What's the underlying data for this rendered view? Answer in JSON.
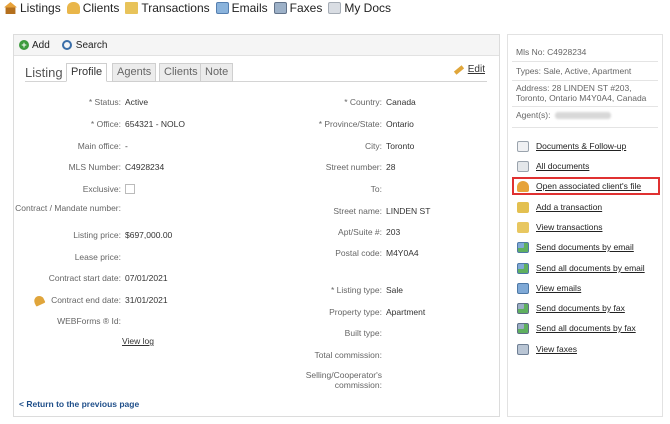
{
  "nav": {
    "items": [
      {
        "label": "Listings",
        "icon": "house-icon"
      },
      {
        "label": "Clients",
        "icon": "clients-icon"
      },
      {
        "label": "Transactions",
        "icon": "folder-icon"
      },
      {
        "label": "Emails",
        "icon": "email-icon"
      },
      {
        "label": "Faxes",
        "icon": "fax-icon"
      },
      {
        "label": "My Docs",
        "icon": "docs-icon"
      }
    ]
  },
  "toolbar": {
    "add_label": "Add",
    "search_label": "Search"
  },
  "tabs": {
    "title": "Listing",
    "items": [
      "Profile",
      "Agents",
      "Clients",
      "Note"
    ],
    "active": "Profile",
    "edit_label": "Edit"
  },
  "left_fields": [
    {
      "label": "* Status:",
      "value": "Active"
    },
    {
      "label": "* Office:",
      "value": "654321 - NOLO"
    },
    {
      "label": "Main office:",
      "value": "-"
    },
    {
      "label": "MLS Number:",
      "value": "C4928234"
    },
    {
      "label": "Exclusive:",
      "value": ""
    },
    {
      "label": "Contract / Mandate number:",
      "value": ""
    },
    {
      "label": "Listing price:",
      "value": "$697,000.00"
    },
    {
      "label": "Lease price:",
      "value": ""
    },
    {
      "label": "Contract start date:",
      "value": "07/01/2021"
    },
    {
      "label": "Contract end date:",
      "value": "31/01/2021"
    },
    {
      "label": "WEBForms ® Id:",
      "value": ""
    }
  ],
  "view_log": "View log",
  "right_fields": [
    {
      "label": "* Country:",
      "value": "Canada"
    },
    {
      "label": "* Province/State:",
      "value": "Ontario"
    },
    {
      "label": "City:",
      "value": "Toronto"
    },
    {
      "label": "Street number:",
      "value": "28"
    },
    {
      "label": "To:",
      "value": ""
    },
    {
      "label": "Street name:",
      "value": "LINDEN ST"
    },
    {
      "label": "Apt/Suite #:",
      "value": "203"
    },
    {
      "label": "Postal code:",
      "value": "M4Y0A4"
    },
    {
      "label": "* Listing type:",
      "value": "Sale"
    },
    {
      "label": "Property type:",
      "value": "Apartment"
    },
    {
      "label": "Built type:",
      "value": ""
    },
    {
      "label": "Total commission:",
      "value": ""
    },
    {
      "label": "Selling/Cooperator's commission:",
      "value": ""
    }
  ],
  "return_link": "< Return to the previous page",
  "side": {
    "mls": "Mls No:  C4928234",
    "types": "Types:  Sale, Active, Apartment",
    "address_line1": "Address:  28 LINDEN ST #203,",
    "address_line2": "Toronto, Ontario M4Y0A4, Canada",
    "agents_label": "Agent(s):",
    "actions": [
      {
        "label": "Documents & Follow-up",
        "icon": "document-icon"
      },
      {
        "label": "All documents",
        "icon": "all-documents-icon"
      },
      {
        "label": "Open associated client's file",
        "icon": "client-file-icon"
      },
      {
        "label": "Add a transaction",
        "icon": "add-transaction-icon"
      },
      {
        "label": "View transactions",
        "icon": "folder-icon"
      },
      {
        "label": "Send documents by email",
        "icon": "email-send-icon"
      },
      {
        "label": "Send all documents by email",
        "icon": "email-send-all-icon"
      },
      {
        "label": "View emails",
        "icon": "emails-icon"
      },
      {
        "label": "Send documents by fax",
        "icon": "fax-send-icon"
      },
      {
        "label": "Send all documents by fax",
        "icon": "fax-send-all-icon"
      },
      {
        "label": "View faxes",
        "icon": "faxes-icon"
      }
    ]
  },
  "colors": {
    "highlight": "#e03131",
    "link": "#1f4f8a"
  }
}
